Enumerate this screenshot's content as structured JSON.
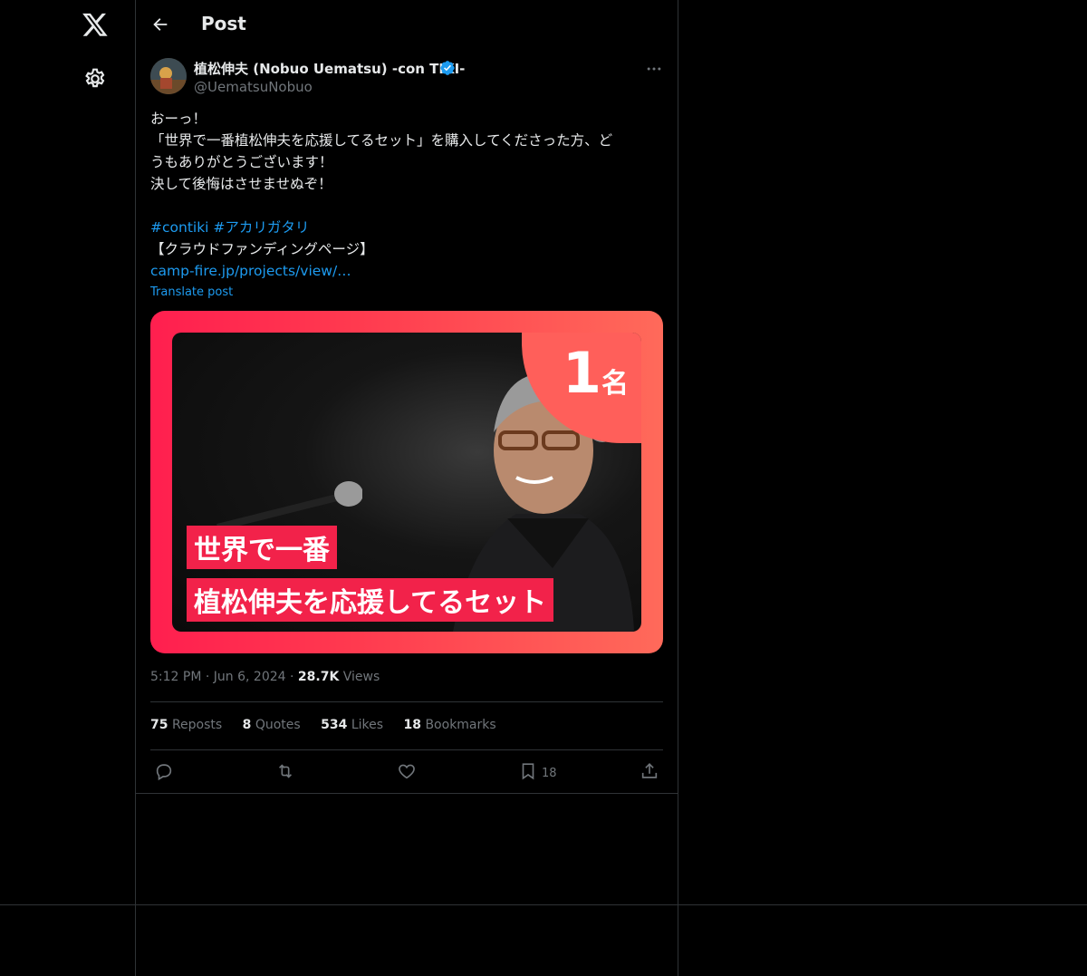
{
  "header": {
    "title": "Post"
  },
  "author": {
    "name": "植松伸夫 (Nobuo Uematsu) -con TIKI-",
    "handle": "@UematsuNobuo"
  },
  "post": {
    "lines": [
      "おーっ！",
      "「世界で一番植松伸夫を応援してるセット」を購入してくださった方、ど",
      "うもありがとうございます！",
      "決して後悔はさせませぬぞ！"
    ],
    "hashtags": "#contiki #アカリガタリ",
    "funding_label": "【クラウドファンディングページ】",
    "link": "camp-fire.jp/projects/view/…",
    "translate": "Translate post"
  },
  "media": {
    "badge_num": "1",
    "badge_unit": "名",
    "caption_line1": "世界で一番",
    "caption_line2": "植松伸夫を応援してるセット"
  },
  "meta": {
    "time": "5:12 PM",
    "date": "Jun 6, 2024",
    "views_count": "28.7K",
    "views_label": "Views"
  },
  "stats": {
    "reposts_count": "75",
    "reposts_label": "Reposts",
    "quotes_count": "8",
    "quotes_label": "Quotes",
    "likes_count": "534",
    "likes_label": "Likes",
    "bookmarks_count": "18",
    "bookmarks_label": "Bookmarks"
  },
  "actions": {
    "bookmark_count": "18"
  },
  "colors": {
    "accent": "#1d9bf0",
    "background": "#000000",
    "border": "#2f3336",
    "secondary_text": "#71767b"
  }
}
